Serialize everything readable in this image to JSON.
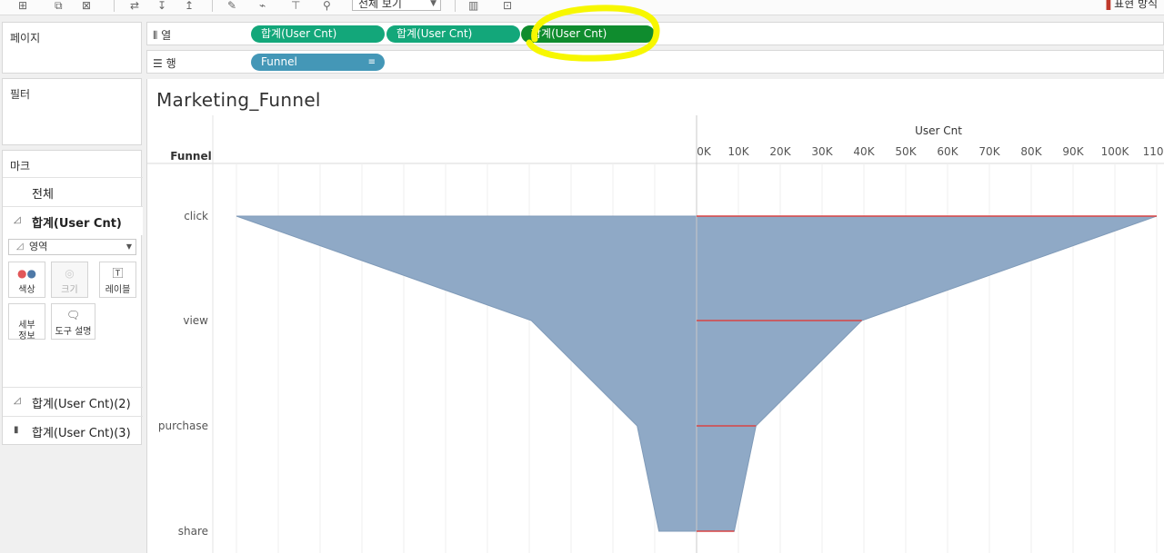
{
  "toolbar": {
    "view_select": "전체 보기",
    "right_label": "표현 방식"
  },
  "left_panel": {
    "pages_title": "페이지",
    "filters_title": "필터",
    "marks_title": "마크",
    "all_label": "전체",
    "active_measure": "합계(User Cnt)",
    "mark_type": "영역",
    "buttons": {
      "color": "색상",
      "size": "크기",
      "label": "레이블",
      "detail": "세부\n정보",
      "tooltip": "도구 설명"
    },
    "measure_2": "합계(User Cnt)(2)",
    "measure_3": "합계(User Cnt)(3)"
  },
  "shelves": {
    "columns_label": "열",
    "rows_label": "행",
    "column_pills": [
      "합계(User Cnt)",
      "합계(User Cnt)",
      "합계(User Cnt)"
    ],
    "row_pill": "Funnel"
  },
  "colors": {
    "area_fill": "#8fa9c6",
    "pill_green": "#13a77a",
    "pill_blue": "#4497b7",
    "highlight": "#f7f700",
    "bar_line": "#d94444"
  },
  "chart_data": {
    "type": "area",
    "title": "Marketing_Funnel",
    "row_header": "Funnel",
    "xlabel": "User Cnt",
    "x_ticks": [
      "0K",
      "10K",
      "20K",
      "30K",
      "40K",
      "50K",
      "60K",
      "70K",
      "80K",
      "90K",
      "100K",
      "110K"
    ],
    "xlim": [
      0,
      110000
    ],
    "categories": [
      "click",
      "view",
      "purchase",
      "share"
    ],
    "series": [
      {
        "values": [
          110000,
          39500,
          14200,
          9000
        ]
      }
    ]
  }
}
